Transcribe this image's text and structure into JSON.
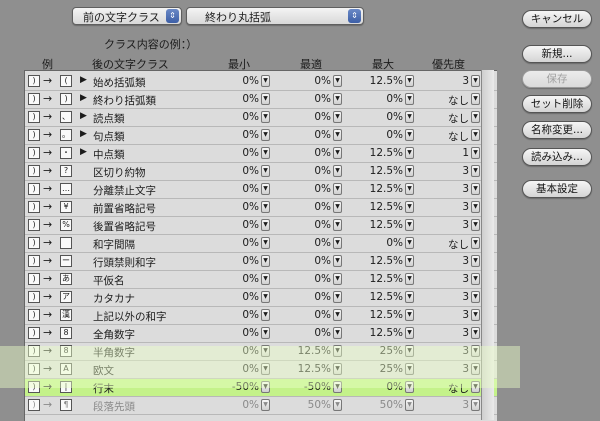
{
  "top": {
    "prev_class": "前の文字クラス",
    "end_class": "終わり丸括弧",
    "caption": "クラス内容の例：）"
  },
  "buttons": {
    "cancel": "キャンセル",
    "new": "新規...",
    "save": "保存",
    "reset": "セット削除",
    "rename": "名称変更...",
    "load": "読み込み...",
    "basic": "基本設定"
  },
  "table": {
    "headers": {
      "example": "例",
      "next_class": "後の文字クラス",
      "min": "最小",
      "opt": "最適",
      "max": "最大",
      "priority": "優先度"
    },
    "rows": [
      {
        "g1": ")",
        "g2": "(",
        "tri": true,
        "label": "始め括弧類",
        "min": "0%",
        "opt": "0%",
        "max": "12.5%",
        "pri": "3"
      },
      {
        "g1": ")",
        "g2": ")",
        "tri": true,
        "label": "終わり括弧類",
        "min": "0%",
        "opt": "0%",
        "max": "0%",
        "pri": "なし"
      },
      {
        "g1": ")",
        "g2": "、",
        "tri": true,
        "label": "読点類",
        "min": "0%",
        "opt": "0%",
        "max": "0%",
        "pri": "なし"
      },
      {
        "g1": ")",
        "g2": "。",
        "tri": true,
        "label": "句点類",
        "min": "0%",
        "opt": "0%",
        "max": "0%",
        "pri": "なし"
      },
      {
        "g1": ")",
        "g2": "・",
        "tri": true,
        "label": "中点類",
        "min": "0%",
        "opt": "0%",
        "max": "12.5%",
        "pri": "1"
      },
      {
        "g1": ")",
        "g2": "?",
        "tri": false,
        "label": "区切り約物",
        "min": "0%",
        "opt": "0%",
        "max": "12.5%",
        "pri": "3"
      },
      {
        "g1": ")",
        "g2": "…",
        "tri": false,
        "label": "分離禁止文字",
        "min": "0%",
        "opt": "0%",
        "max": "12.5%",
        "pri": "3"
      },
      {
        "g1": ")",
        "g2": "¥",
        "tri": false,
        "label": "前置省略記号",
        "min": "0%",
        "opt": "0%",
        "max": "12.5%",
        "pri": "3"
      },
      {
        "g1": ")",
        "g2": "%",
        "tri": false,
        "label": "後置省略記号",
        "min": "0%",
        "opt": "0%",
        "max": "12.5%",
        "pri": "3"
      },
      {
        "g1": ")",
        "g2": " ",
        "tri": false,
        "label": "和字間隔",
        "min": "0%",
        "opt": "0%",
        "max": "0%",
        "pri": "なし"
      },
      {
        "g1": ")",
        "g2": "ー",
        "tri": false,
        "label": "行頭禁則和字",
        "min": "0%",
        "opt": "0%",
        "max": "12.5%",
        "pri": "3"
      },
      {
        "g1": ")",
        "g2": "あ",
        "tri": false,
        "label": "平仮名",
        "min": "0%",
        "opt": "0%",
        "max": "12.5%",
        "pri": "3"
      },
      {
        "g1": ")",
        "g2": "ア",
        "tri": false,
        "label": "カタカナ",
        "min": "0%",
        "opt": "0%",
        "max": "12.5%",
        "pri": "3"
      },
      {
        "g1": ")",
        "g2": "漢",
        "tri": false,
        "label": "上記以外の和字",
        "min": "0%",
        "opt": "0%",
        "max": "12.5%",
        "pri": "3"
      },
      {
        "g1": ")",
        "g2": "8",
        "tri": false,
        "label": "全角数字",
        "min": "0%",
        "opt": "0%",
        "max": "12.5%",
        "pri": "3"
      },
      {
        "g1": ")",
        "g2": "8",
        "tri": false,
        "label": "半角数字",
        "min": "0%",
        "opt": "12.5%",
        "max": "25%",
        "pri": "3"
      },
      {
        "g1": ")",
        "g2": "A",
        "tri": false,
        "label": "欧文",
        "min": "0%",
        "opt": "12.5%",
        "max": "25%",
        "pri": "3"
      },
      {
        "g1": ")",
        "g2": "|",
        "tri": false,
        "label": "行末",
        "min": "-50%",
        "opt": "-50%",
        "max": "0%",
        "pri": "なし"
      },
      {
        "g1": ")",
        "g2": "¶",
        "tri": false,
        "label": "段落先頭",
        "min": "0%",
        "opt": "50%",
        "max": "50%",
        "pri": "3"
      }
    ]
  }
}
